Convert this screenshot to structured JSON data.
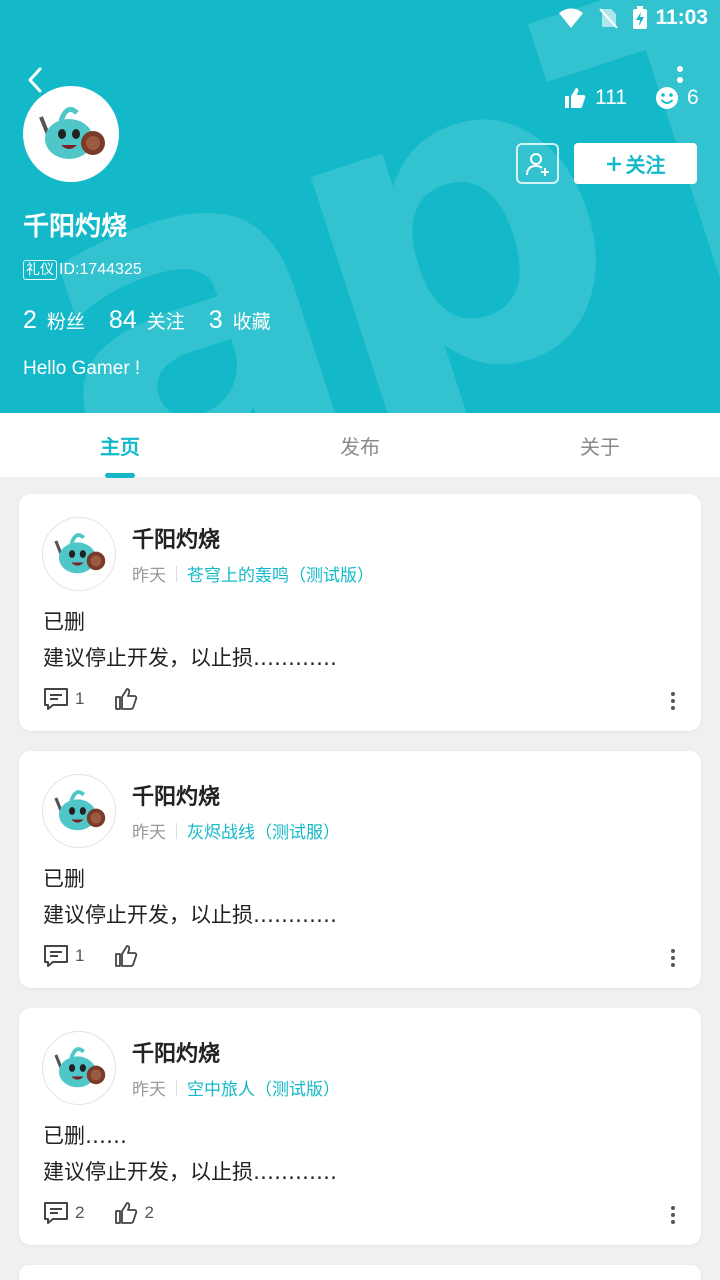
{
  "status_bar": {
    "time": "11:03"
  },
  "profile": {
    "name": "千阳灼烧",
    "badge": "礼仪",
    "id_text": "ID:1744325",
    "likes": "111",
    "smiles": "6",
    "follow_label": "关注",
    "stats": [
      {
        "num": "2",
        "label": "粉丝"
      },
      {
        "num": "84",
        "label": "关注"
      },
      {
        "num": "3",
        "label": "收藏"
      }
    ],
    "bio": "Hello Gamer !"
  },
  "tabs": [
    {
      "label": "主页",
      "active": true
    },
    {
      "label": "发布",
      "active": false
    },
    {
      "label": "关于",
      "active": false
    }
  ],
  "posts": [
    {
      "author": "千阳灼烧",
      "time": "昨天",
      "game": "苍穹上的轰鸣（测试版）",
      "line1": "已删",
      "line2": "建议停止开发，以止损…………",
      "comments": "1",
      "likes": ""
    },
    {
      "author": "千阳灼烧",
      "time": "昨天",
      "game": "灰烬战线（测试服）",
      "line1": "已删",
      "line2": "建议停止开发，以止损…………",
      "comments": "1",
      "likes": ""
    },
    {
      "author": "千阳灼烧",
      "time": "昨天",
      "game": "空中旅人（测试版）",
      "line1": "已删……",
      "line2": "建议停止开发，以止损…………",
      "comments": "2",
      "likes": "2"
    }
  ],
  "colors": {
    "accent": "#14b9c9"
  },
  "icons": [
    "back-arrow-icon",
    "thumbs-up-icon",
    "smile-icon",
    "more-vertical-icon",
    "add-user-icon",
    "plus-icon",
    "comment-icon",
    "wifi-icon",
    "no-sim-icon",
    "battery-charging-icon"
  ]
}
